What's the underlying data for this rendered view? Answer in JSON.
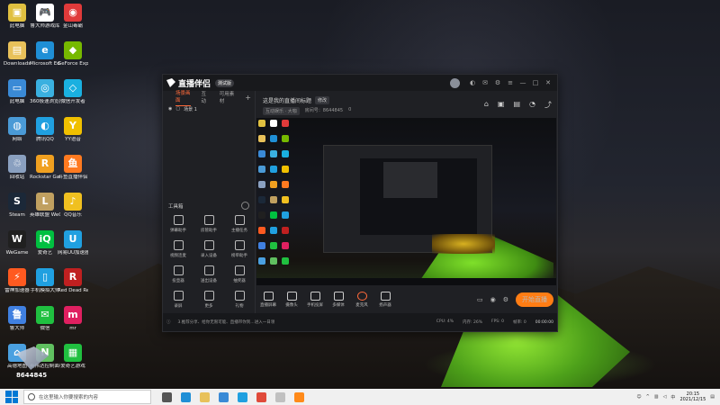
{
  "desktop": {
    "icons": [
      {
        "label": "此电脑",
        "color": "#e0c040",
        "glyph": "▣"
      },
      {
        "label": "鲁大师游戏库",
        "color": "#ffffff",
        "glyph": "🎮"
      },
      {
        "label": "金山毒霸",
        "color": "#e03a3a",
        "glyph": "◉"
      },
      {
        "label": "Downloads",
        "color": "#e8c15a",
        "glyph": "▤"
      },
      {
        "label": "Microsoft Edge",
        "color": "#1f8fd6",
        "glyph": "e"
      },
      {
        "label": "GeForce Experience",
        "color": "#76b900",
        "glyph": "◆"
      },
      {
        "label": "此电脑",
        "color": "#3a8ad6",
        "glyph": "▭"
      },
      {
        "label": "360极速浏览器",
        "color": "#3ab0e0",
        "glyph": "◎"
      },
      {
        "label": "微信开发者",
        "color": "#1ab0e0",
        "glyph": "◇"
      },
      {
        "label": "网络",
        "color": "#4a9ad6",
        "glyph": "◍"
      },
      {
        "label": "腾讯QQ",
        "color": "#20a0e0",
        "glyph": "◐"
      },
      {
        "label": "YY语音",
        "color": "#f0c000",
        "glyph": "Y"
      },
      {
        "label": "回收站",
        "color": "#8aa0c0",
        "glyph": "♲"
      },
      {
        "label": "Rockstar Games...",
        "color": "#f0a020",
        "glyph": "R"
      },
      {
        "label": "斗鱼直播伴侣",
        "color": "#ff7a20",
        "glyph": "鱼"
      },
      {
        "label": "Steam",
        "color": "#1b2838",
        "glyph": "S"
      },
      {
        "label": "英雄联盟 WeGame版",
        "color": "#c0a060",
        "glyph": "L"
      },
      {
        "label": "QQ音乐",
        "color": "#f0c020",
        "glyph": "♪"
      },
      {
        "label": "WeGame",
        "color": "#202020",
        "glyph": "W"
      },
      {
        "label": "爱奇艺",
        "color": "#00c040",
        "glyph": "iQ"
      },
      {
        "label": "网易UU加速器",
        "color": "#20a0e0",
        "glyph": "U"
      },
      {
        "label": "雷神加速器",
        "color": "#ff5a20",
        "glyph": "⚡"
      },
      {
        "label": "手机模拟大师",
        "color": "#20a0e0",
        "glyph": "▯"
      },
      {
        "label": "Red Dead Redemption",
        "color": "#c02020",
        "glyph": "R"
      },
      {
        "label": "鲁大师",
        "color": "#4080e0",
        "glyph": "鲁"
      },
      {
        "label": "微信",
        "color": "#20c040",
        "glyph": "✉"
      },
      {
        "label": "mr",
        "color": "#e02060",
        "glyph": "m"
      },
      {
        "label": "高德地图",
        "color": "#4aa0e0",
        "glyph": "⌂"
      },
      {
        "label": "英伟达控制面板",
        "color": "#60c060",
        "glyph": "N"
      },
      {
        "label": "爱奇艺游戏",
        "color": "#20c040",
        "glyph": "▦"
      }
    ]
  },
  "app": {
    "title": "直播伴侣",
    "version": "测试版",
    "titlebar_icons": [
      "avatar",
      "skin-icon",
      "message-icon",
      "settings-icon",
      "menu-icon",
      "minimize-icon",
      "maximize-icon",
      "close-icon"
    ],
    "left_tabs": [
      "场景画面",
      "互动",
      "可用素材"
    ],
    "add_label": "+",
    "scene_label": "场景 1",
    "tools_header": "工具箱",
    "tools": [
      {
        "label": "弹幕助手"
      },
      {
        "label": "房管助手"
      },
      {
        "label": "主播任务"
      },
      {
        "label": "视频连麦"
      },
      {
        "label": "录入设备"
      },
      {
        "label": "榜单助手"
      },
      {
        "label": "投壶器"
      },
      {
        "label": "送出设备"
      },
      {
        "label": "抽奖器"
      },
      {
        "label": "录屏"
      },
      {
        "label": "更多"
      },
      {
        "label": "礼物"
      }
    ],
    "room_title": "这是我的直播间标题",
    "edit_label": "修改",
    "category": "互动娱乐 · 大咖",
    "room_info": "房间号：8644845",
    "fans": "0",
    "right_icons": [
      "gift-icon",
      "shop-icon",
      "task-icon",
      "bell-icon",
      "share-icon"
    ],
    "controls": [
      {
        "label": "直播屏幕"
      },
      {
        "label": "摄像头"
      },
      {
        "label": "手机投屏"
      },
      {
        "label": "多媒体"
      },
      {
        "label": "麦克风"
      },
      {
        "label": "扬声器"
      }
    ],
    "start_button": "开始直播",
    "status_tip": "3.推荐分享、给你无限可能、直播带你到…进入一日领",
    "status_items": [
      "CPU: 4%",
      "内存: 26%",
      "FPS: 0",
      "帧率: 0"
    ],
    "status_time": "00:00:00",
    "watermark_number": "8644845"
  },
  "taskbar": {
    "search_placeholder": "在这里输入你要搜索的内容",
    "time": "20:15",
    "date": "2021/12/15",
    "ime": "中",
    "apps": [
      {
        "name": "task-view",
        "color": "#555"
      },
      {
        "name": "edge",
        "color": "#1f8fd6"
      },
      {
        "name": "explorer",
        "color": "#e8c15a"
      },
      {
        "name": "store",
        "color": "#3a8ad6"
      },
      {
        "name": "qq",
        "color": "#20a0e0"
      },
      {
        "name": "chrome",
        "color": "#e04a3a"
      },
      {
        "name": "app1",
        "color": "#c0c0c0"
      },
      {
        "name": "douyu",
        "color": "#ff8a1a"
      }
    ]
  }
}
